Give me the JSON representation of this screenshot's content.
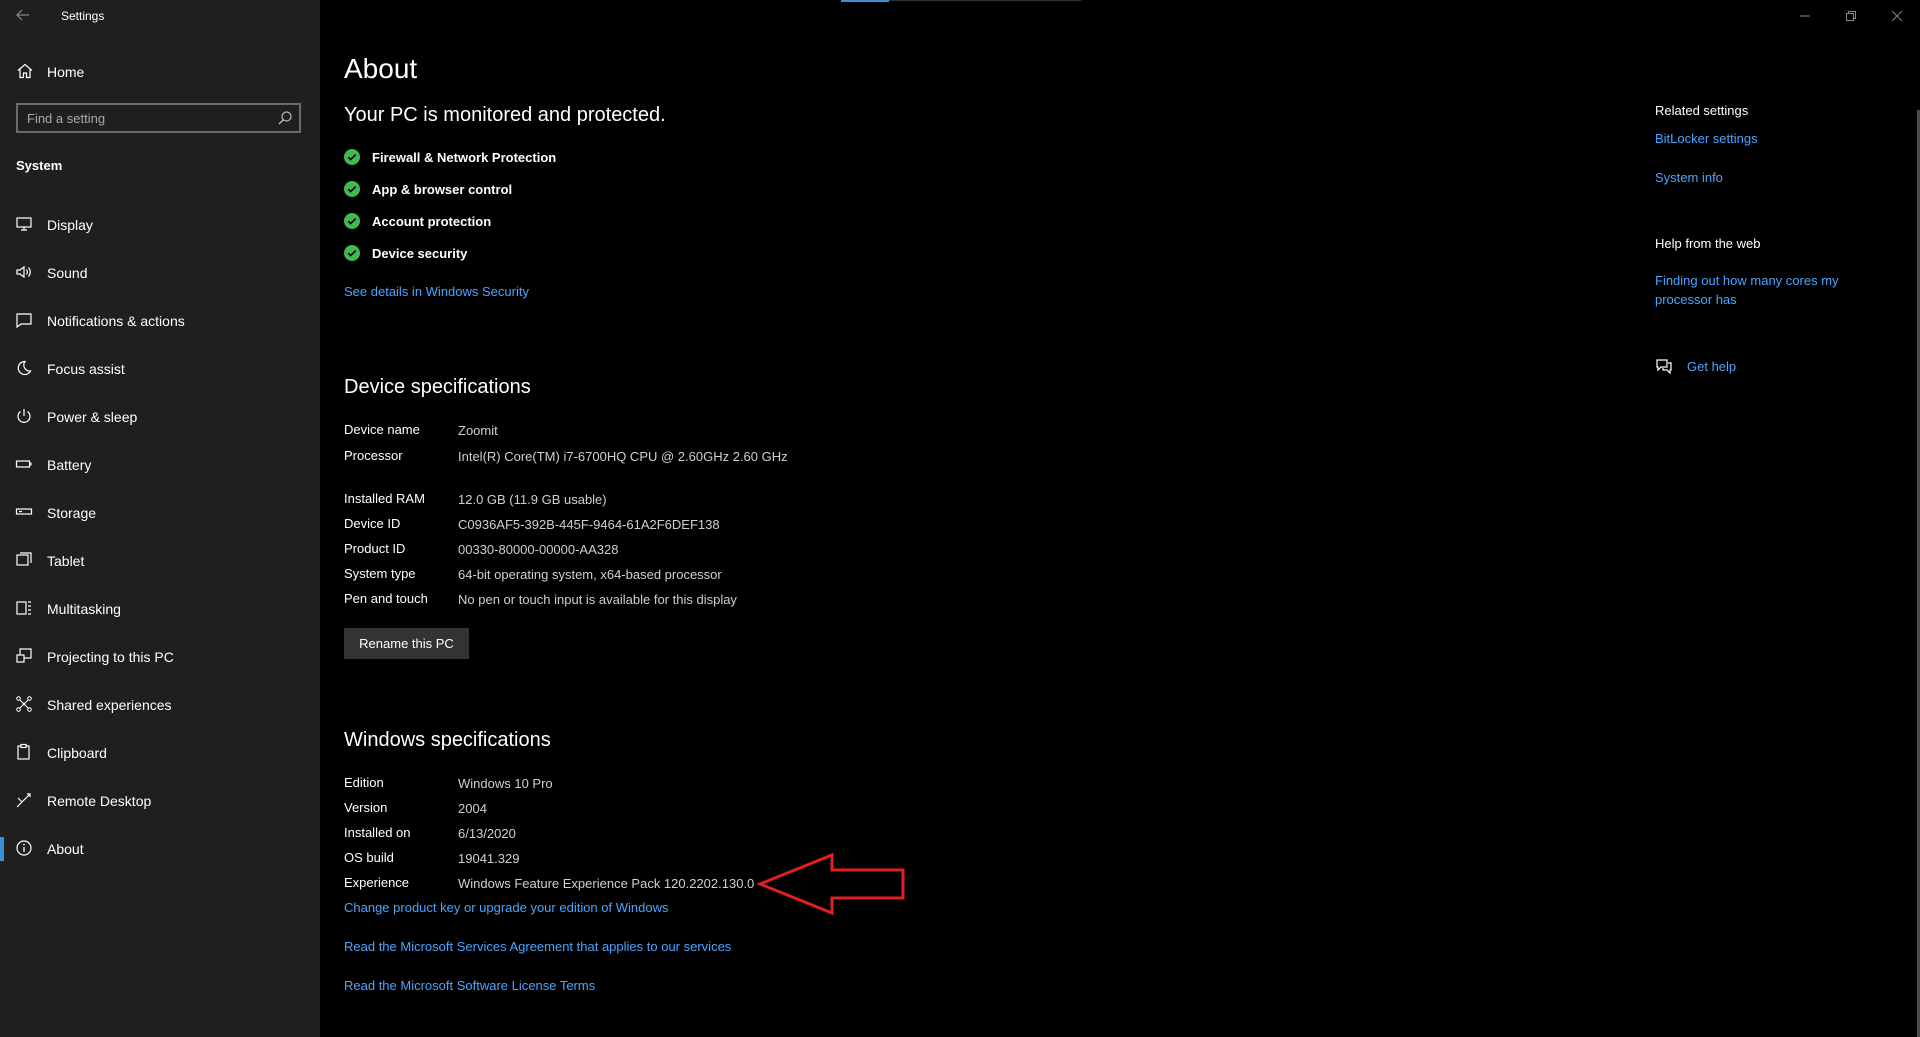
{
  "window": {
    "title": "Settings"
  },
  "sidebar": {
    "home_label": "Home",
    "search_placeholder": "Find a setting",
    "section_label": "System",
    "items": [
      {
        "label": "Display",
        "icon": "monitor-icon"
      },
      {
        "label": "Sound",
        "icon": "speaker-icon"
      },
      {
        "label": "Notifications & actions",
        "icon": "notification-icon"
      },
      {
        "label": "Focus assist",
        "icon": "moon-icon"
      },
      {
        "label": "Power & sleep",
        "icon": "power-icon"
      },
      {
        "label": "Battery",
        "icon": "battery-icon"
      },
      {
        "label": "Storage",
        "icon": "storage-icon"
      },
      {
        "label": "Tablet",
        "icon": "tablet-icon"
      },
      {
        "label": "Multitasking",
        "icon": "multitasking-icon"
      },
      {
        "label": "Projecting to this PC",
        "icon": "projecting-icon"
      },
      {
        "label": "Shared experiences",
        "icon": "shared-icon"
      },
      {
        "label": "Clipboard",
        "icon": "clipboard-icon"
      },
      {
        "label": "Remote Desktop",
        "icon": "remote-desktop-icon"
      },
      {
        "label": "About",
        "icon": "info-icon",
        "active": true
      }
    ]
  },
  "main": {
    "title": "About",
    "protection": {
      "heading": "Your PC is monitored and protected.",
      "items": [
        "Firewall & Network Protection",
        "App & browser control",
        "Account protection",
        "Device security"
      ],
      "link": "See details in Windows Security"
    },
    "device_specs": {
      "heading": "Device specifications",
      "rows": [
        {
          "key": "Device name",
          "value": "Zoomit"
        },
        {
          "key": "Processor",
          "value": "Intel(R) Core(TM) i7-6700HQ CPU @ 2.60GHz   2.60 GHz"
        },
        {
          "key": "Installed RAM",
          "value": "12.0 GB (11.9 GB usable)"
        },
        {
          "key": "Device ID",
          "value": "C0936AF5-392B-445F-9464-61A2F6DEF138"
        },
        {
          "key": "Product ID",
          "value": "00330-80000-00000-AA328"
        },
        {
          "key": "System type",
          "value": "64-bit operating system, x64-based processor"
        },
        {
          "key": "Pen and touch",
          "value": "No pen or touch input is available for this display"
        }
      ],
      "rename_button": "Rename this PC"
    },
    "windows_specs": {
      "heading": "Windows specifications",
      "rows": [
        {
          "key": "Edition",
          "value": "Windows 10 Pro"
        },
        {
          "key": "Version",
          "value": "2004"
        },
        {
          "key": "Installed on",
          "value": "6/13/2020"
        },
        {
          "key": "OS build",
          "value": "19041.329"
        },
        {
          "key": "Experience",
          "value": "Windows Feature Experience Pack 120.2202.130.0"
        }
      ],
      "links": [
        "Change product key or upgrade your edition of Windows",
        "Read the Microsoft Services Agreement that applies to our services",
        "Read the Microsoft Software License Terms"
      ]
    }
  },
  "related": {
    "heading": "Related settings",
    "links": [
      "BitLocker settings",
      "System info"
    ],
    "help_heading": "Help from the web",
    "help_link": "Finding out how many cores my processor has",
    "get_help": "Get help"
  },
  "colors": {
    "accent": "#4ba3ff",
    "check": "#3fb950",
    "annotation_arrow": "#e02020",
    "sidebar": "#1f1f1f"
  }
}
